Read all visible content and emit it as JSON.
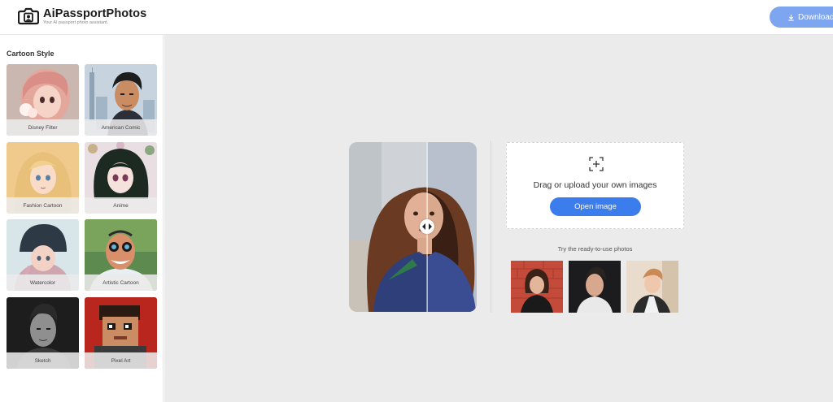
{
  "header": {
    "brand": "AiPassportPhotos",
    "tagline": "Your AI passport photo assistant.",
    "download_label": "Download"
  },
  "sidebar": {
    "title": "Cartoon Style",
    "styles": [
      {
        "label": "Disney Filter"
      },
      {
        "label": "American Comic"
      },
      {
        "label": "Fashion Cartoon"
      },
      {
        "label": "Anime"
      },
      {
        "label": "Watercolor"
      },
      {
        "label": "Artistic Cartoon"
      },
      {
        "label": "Sketch"
      },
      {
        "label": "Pixel Art"
      }
    ]
  },
  "upload": {
    "prompt": "Drag or upload your own images",
    "button_label": "Open image"
  },
  "samples": {
    "heading": "Try the ready-to-use photos"
  },
  "icons": {
    "logo": "camera-frame-icon",
    "download": "download-icon",
    "upload": "add-image-icon",
    "compare_handle": "compare-arrows-icon"
  },
  "colors": {
    "accent": "#3b7ded",
    "download_button": "#7ea6f0",
    "workspace_bg": "#ebebeb"
  }
}
